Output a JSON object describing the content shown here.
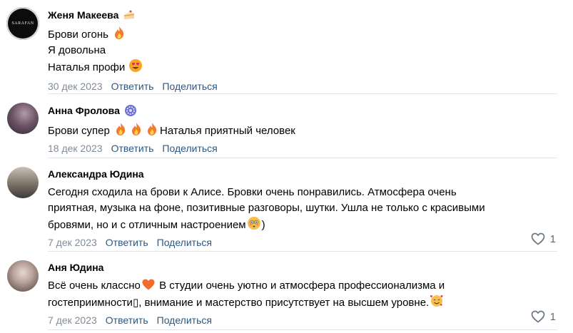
{
  "comments": [
    {
      "author": "Женя Макеева",
      "lines": [
        "Брови огонь",
        "Я довольна",
        "Наталья профи"
      ],
      "date": "30 дек 2023",
      "reply": "Ответить",
      "share": "Поделиться",
      "avatar_text": "SARAFAN"
    },
    {
      "author": "Анна Фролова",
      "line1_text": "Брови супер ",
      "line1_tail": "Наталья приятный человек",
      "date": "18 дек 2023",
      "reply": "Ответить",
      "share": "Поделиться"
    },
    {
      "author": "Александра Юдина",
      "lines": [
        "Сегодня сходила на брови к Алисе. Бровки очень понравились. Атмосфера очень",
        "приятная, музыка на фоне, позитивные разговоры, шутки. Ушла не только с красивыми",
        "бровями, но и с отличным настроением"
      ],
      "line3_tail": ")",
      "date": "7 дек 2023",
      "reply": "Ответить",
      "share": "Поделиться",
      "likes": "1"
    },
    {
      "author": "Аня Юдина",
      "line1_a": "Всё очень классно",
      "line1_b": " В студии очень уютно и атмосфера профессионализма и",
      "line2": "гостеприимности▯, внимание и мастерство присутствует на высшем уровне.",
      "date": "7 дек 2023",
      "reply": "Ответить",
      "share": "Поделиться",
      "likes": "1"
    }
  ]
}
